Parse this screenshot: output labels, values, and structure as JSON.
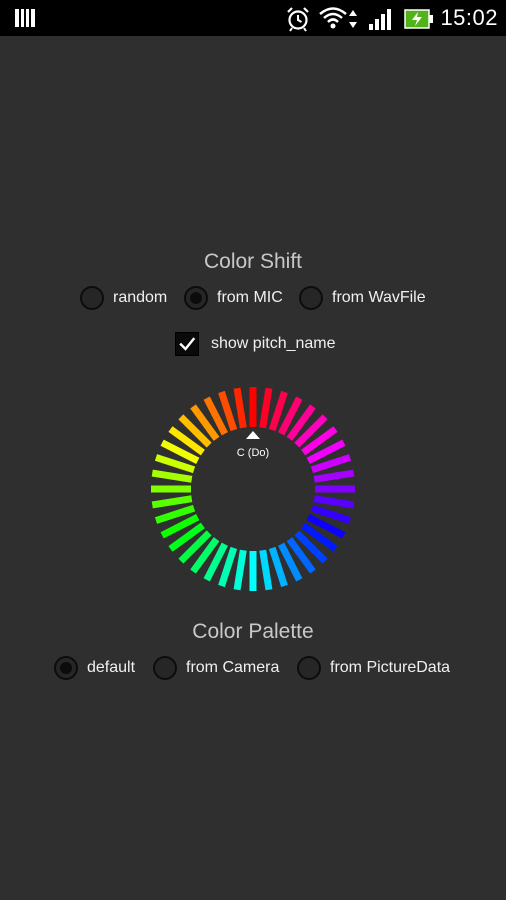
{
  "status_bar": {
    "time": "15:02",
    "icons": [
      "notification-icon",
      "alarm-icon",
      "wifi-icon",
      "signal-icon",
      "battery-charging-icon"
    ]
  },
  "color_shift": {
    "title": "Color Shift",
    "options": [
      {
        "label": "random",
        "selected": false
      },
      {
        "label": "from MIC",
        "selected": true
      },
      {
        "label": "from WavFile",
        "selected": false
      }
    ],
    "show_pitch_label": "show pitch_name",
    "show_pitch_checked": true
  },
  "wheel": {
    "pitch_label": "C (Do)"
  },
  "color_palette": {
    "title": "Color Palette",
    "options": [
      {
        "label": "default",
        "selected": true
      },
      {
        "label": "from Camera",
        "selected": false
      },
      {
        "label": "from PictureData",
        "selected": false
      }
    ]
  }
}
